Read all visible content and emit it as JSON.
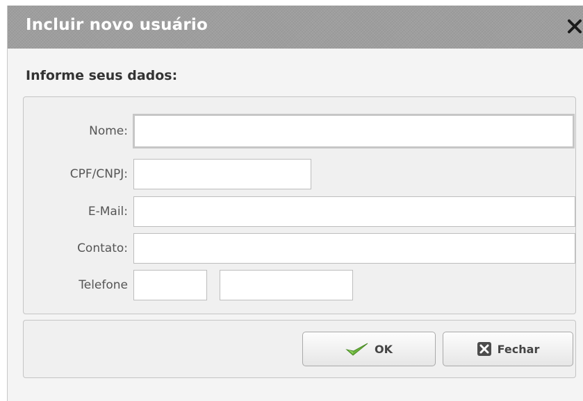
{
  "dialog": {
    "title": "Incluir novo usuário",
    "close_icon": "close-icon",
    "subtitle": "Informe seus dados:"
  },
  "form": {
    "required_marker": "*",
    "required_color": "#e02020",
    "fields": {
      "nome": {
        "label": "Nome:",
        "value": ""
      },
      "cpf_cnpj": {
        "label": "CPF/CNPJ:",
        "value": ""
      },
      "email": {
        "label": "E-Mail:",
        "value": ""
      },
      "contato": {
        "label": "Contato:",
        "value": ""
      },
      "telefone": {
        "label": "Telefone",
        "ddd_value": "",
        "number_value": ""
      }
    }
  },
  "buttons": {
    "ok": {
      "label": "OK",
      "icon": "checkmark-icon",
      "icon_color": "#6cb33e"
    },
    "fechar": {
      "label": "Fechar",
      "icon": "close-box-icon"
    }
  },
  "colors": {
    "titlebar": "#9e9e9e",
    "background": "#f4f4f4"
  }
}
